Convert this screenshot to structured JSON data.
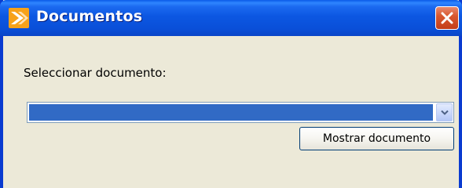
{
  "window": {
    "title": "Documentos"
  },
  "form": {
    "label": "Seleccionar documento:",
    "select": {
      "selected_value": ""
    },
    "show_button_label": "Mostrar documento"
  },
  "colors": {
    "titlebar": "#0a4fd8",
    "selection_highlight": "#316ac5",
    "dialog_background": "#ece9d8",
    "close_button": "#d9582f"
  },
  "icons": {
    "app": "app-logo-icon",
    "close": "close-icon",
    "dropdown": "chevron-down-icon"
  }
}
